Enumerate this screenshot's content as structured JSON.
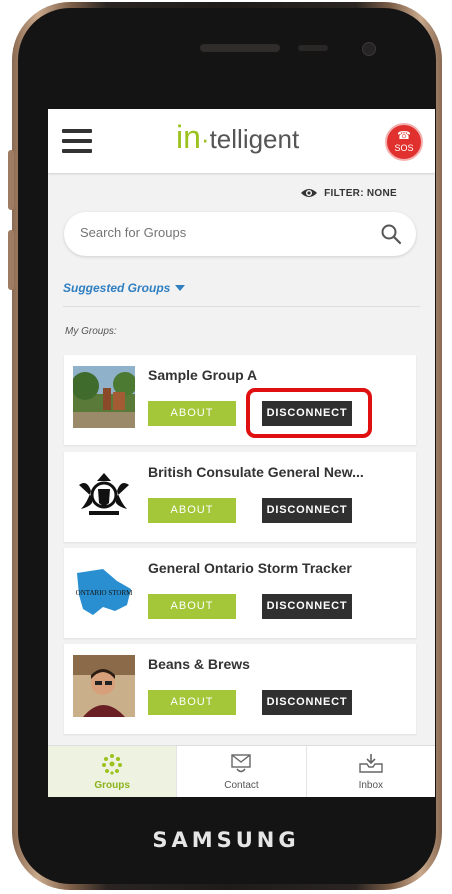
{
  "device": {
    "brand": "SAMSUNG"
  },
  "appbar": {
    "logo_in": "in",
    "logo_dot": "·",
    "logo_rest": "telligent",
    "sos_label": "SOS"
  },
  "filter": {
    "label": "FILTER: NONE"
  },
  "search": {
    "placeholder": "Search for Groups"
  },
  "suggested": {
    "label": "Suggested Groups"
  },
  "my_groups": {
    "label": "My Groups:"
  },
  "groups": [
    {
      "name": "Sample Group A",
      "about": "ABOUT",
      "disconnect": "DISCONNECT"
    },
    {
      "name": "British Consulate General New...",
      "about": "ABOUT",
      "disconnect": "DISCONNECT"
    },
    {
      "name": "General Ontario Storm Tracker",
      "about": "ABOUT",
      "disconnect": "DISCONNECT",
      "thumb_text": "ONTARIO STORM"
    },
    {
      "name": "Beans & Brews",
      "about": "ABOUT",
      "disconnect": "DISCONNECT"
    }
  ],
  "tabs": [
    {
      "label": "Groups",
      "icon": "groups-icon",
      "active": true
    },
    {
      "label": "Contact",
      "icon": "contact-icon",
      "active": false
    },
    {
      "label": "Inbox",
      "icon": "inbox-icon",
      "active": false
    }
  ],
  "colors": {
    "accent": "#a4c639",
    "link": "#2f7fc1",
    "sos": "#e0312e",
    "highlight": "#e01010",
    "button_dark": "#303030"
  }
}
